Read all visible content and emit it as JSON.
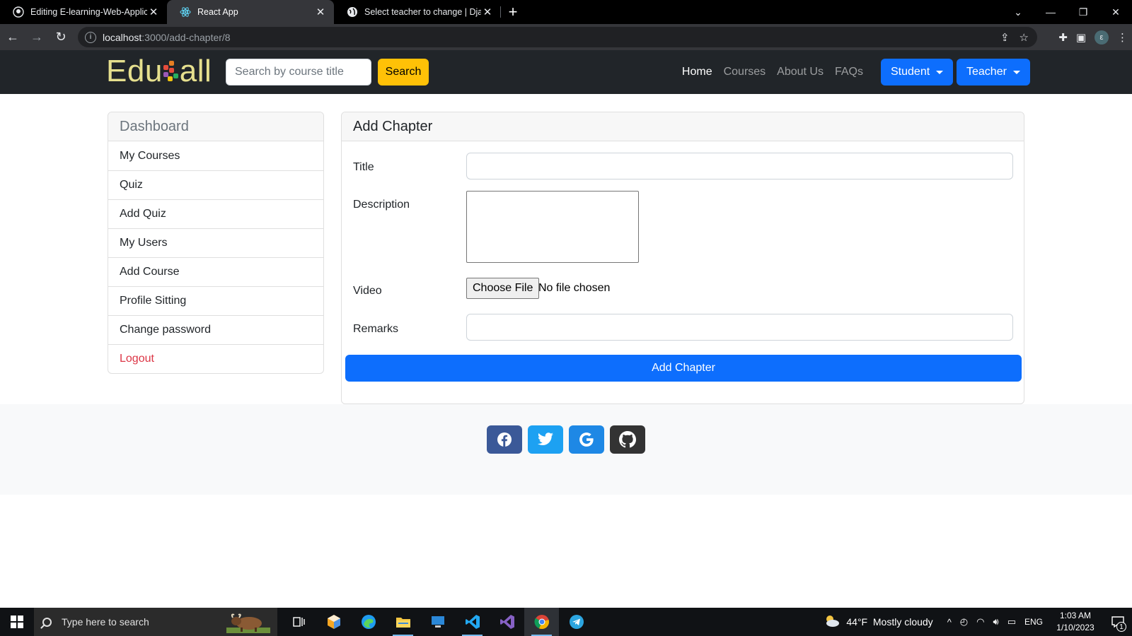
{
  "browser": {
    "tabs": [
      {
        "title": "Editing E-learning-Web-Applicati",
        "icon": "github-icon",
        "active": false
      },
      {
        "title": "React App",
        "icon": "react-icon",
        "active": true
      },
      {
        "title": "Select teacher to change | Djang",
        "icon": "globe-icon",
        "active": false
      }
    ],
    "url_host": "localhost",
    "url_rest": ":3000/add-chapter/8",
    "profile_initial": "ε"
  },
  "site": {
    "brand_left": "Edu",
    "brand_right": "all",
    "search_placeholder": "Search by course title",
    "search_button": "Search",
    "nav": {
      "home": "Home",
      "courses": "Courses",
      "about": "About Us",
      "faqs": "FAQs"
    },
    "student_button": "Student",
    "teacher_button": "Teacher"
  },
  "sidebar": {
    "title": "Dashboard",
    "items": [
      "My Courses",
      "Quiz",
      "Add Quiz",
      "My Users",
      "Add Course",
      "Profile Sitting",
      "Change password"
    ],
    "logout": "Logout"
  },
  "form": {
    "title": "Add Chapter",
    "labels": {
      "title": "Title",
      "description": "Description",
      "video": "Video",
      "remarks": "Remarks"
    },
    "values": {
      "title": "",
      "description": "",
      "remarks": ""
    },
    "file_button": "Choose File",
    "file_status": "No file chosen",
    "submit": "Add Chapter"
  },
  "footer": {
    "social": [
      {
        "icon": "facebook-icon",
        "color": "#3b5998"
      },
      {
        "icon": "twitter-icon",
        "color": "#1da1f2"
      },
      {
        "icon": "google-icon",
        "color": "#1e88e5"
      },
      {
        "icon": "github-icon",
        "color": "#333333"
      }
    ]
  },
  "taskbar": {
    "search_placeholder": "Type here to search",
    "weather": "44°F  Mostly cloudy",
    "lang": "ENG",
    "time": "1:03 AM",
    "date": "1/10/2023",
    "notification_count": "1"
  },
  "colors": {
    "primary": "#0d6efd",
    "warning": "#ffc107",
    "danger": "#dc3545",
    "navbar": "#212529"
  }
}
